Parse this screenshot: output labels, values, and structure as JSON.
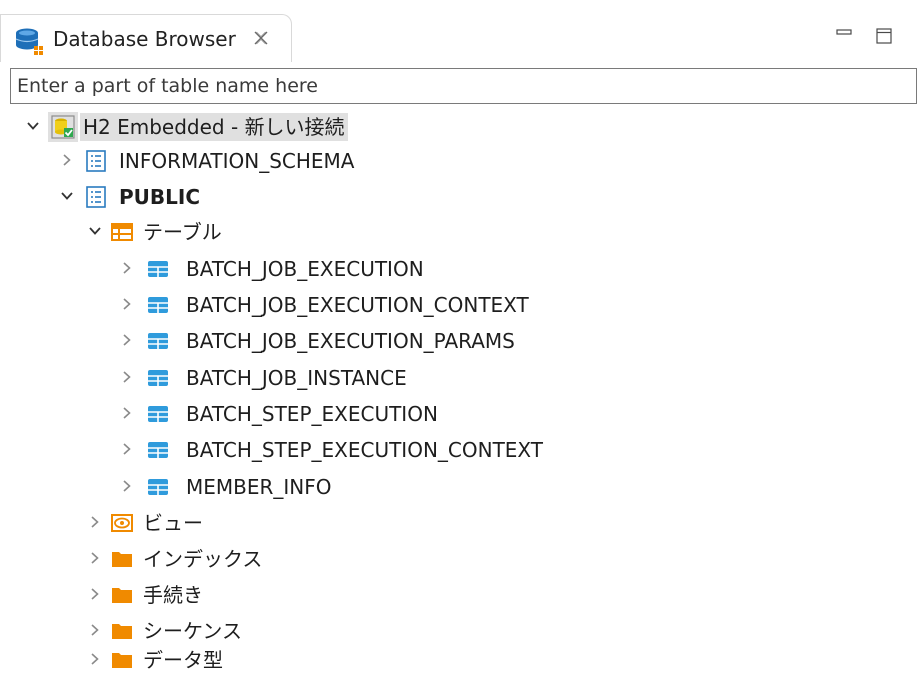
{
  "view": {
    "title": "Database Browser",
    "tab_icon": "database-icon",
    "close_icon": "close-icon",
    "minimize_icon": "minimize-icon",
    "maximize_icon": "maximize-icon"
  },
  "filter": {
    "placeholder": "Enter a part of table name here",
    "value": ""
  },
  "tree": {
    "connection": {
      "label": "H2 Embedded - 新しい接続",
      "expanded": true,
      "icon": "connection-icon"
    },
    "schemas": [
      {
        "label": "INFORMATION_SCHEMA",
        "expanded": false,
        "icon": "schema-icon"
      },
      {
        "label": "PUBLIC",
        "expanded": true,
        "icon": "schema-icon"
      }
    ],
    "public_children": {
      "tables_folder": {
        "label": "テーブル",
        "expanded": true,
        "icon": "tables-folder-icon"
      },
      "tables": [
        {
          "label": "BATCH_JOB_EXECUTION"
        },
        {
          "label": "BATCH_JOB_EXECUTION_CONTEXT"
        },
        {
          "label": "BATCH_JOB_EXECUTION_PARAMS"
        },
        {
          "label": "BATCH_JOB_INSTANCE"
        },
        {
          "label": "BATCH_STEP_EXECUTION"
        },
        {
          "label": "BATCH_STEP_EXECUTION_CONTEXT"
        },
        {
          "label": "MEMBER_INFO"
        }
      ],
      "other_folders": [
        {
          "label": "ビュー",
          "icon": "view-icon"
        },
        {
          "label": "インデックス",
          "icon": "folder-icon"
        },
        {
          "label": "手続き",
          "icon": "folder-icon"
        },
        {
          "label": "シーケンス",
          "icon": "folder-icon"
        },
        {
          "label": "データ型",
          "icon": "folder-icon"
        }
      ]
    }
  },
  "colors": {
    "folder": "#f08a00",
    "table": "#2f9bdc",
    "schema": "#2a7bbf",
    "selection": "#e0e0e0"
  }
}
